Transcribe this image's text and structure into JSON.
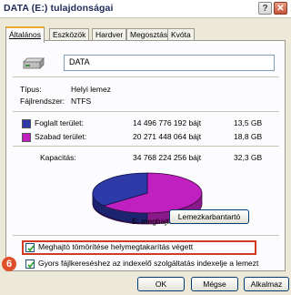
{
  "window": {
    "title": "DATA (E:) tulajdonságai",
    "help_label": "?",
    "close_label": "✕"
  },
  "tabs": [
    {
      "label": "Általános",
      "active": true
    },
    {
      "label": "Eszközök"
    },
    {
      "label": "Hardver"
    },
    {
      "label": "Megosztás"
    },
    {
      "label": "Kvóta"
    }
  ],
  "general": {
    "drive_icon": "hard-drive-icon",
    "name_value": "DATA",
    "type_label": "Típus:",
    "type_value": "Helyi lemez",
    "fs_label": "Fájlrendszer:",
    "fs_value": "NTFS"
  },
  "usage": {
    "used": {
      "label": "Foglalt terület:",
      "bytes": "14 496 776 192 bájt",
      "size": "13,5 GB",
      "color": "#2e3aa8"
    },
    "free": {
      "label": "Szabad terület:",
      "bytes": "20 271 448 064 bájt",
      "size": "18,8 GB",
      "color": "#c020c0"
    },
    "capacity": {
      "label": "Kapacitás:",
      "bytes": "34 768 224 256 bájt",
      "size": "32,3 GB"
    },
    "drive_label": "E: meghajtó",
    "cleanup_label": "Lemezkarbantartó"
  },
  "options": {
    "compress_label": "Meghajtó tömörítése helymegtakarítás végett",
    "compress_checked": true,
    "index_label": "Gyors fájlkereséshez az indexelő szolgáltatás indexelje a lemezt",
    "index_checked": true
  },
  "callout": "6",
  "buttons": {
    "ok": "OK",
    "cancel": "Mégse",
    "apply": "Alkalmaz"
  }
}
